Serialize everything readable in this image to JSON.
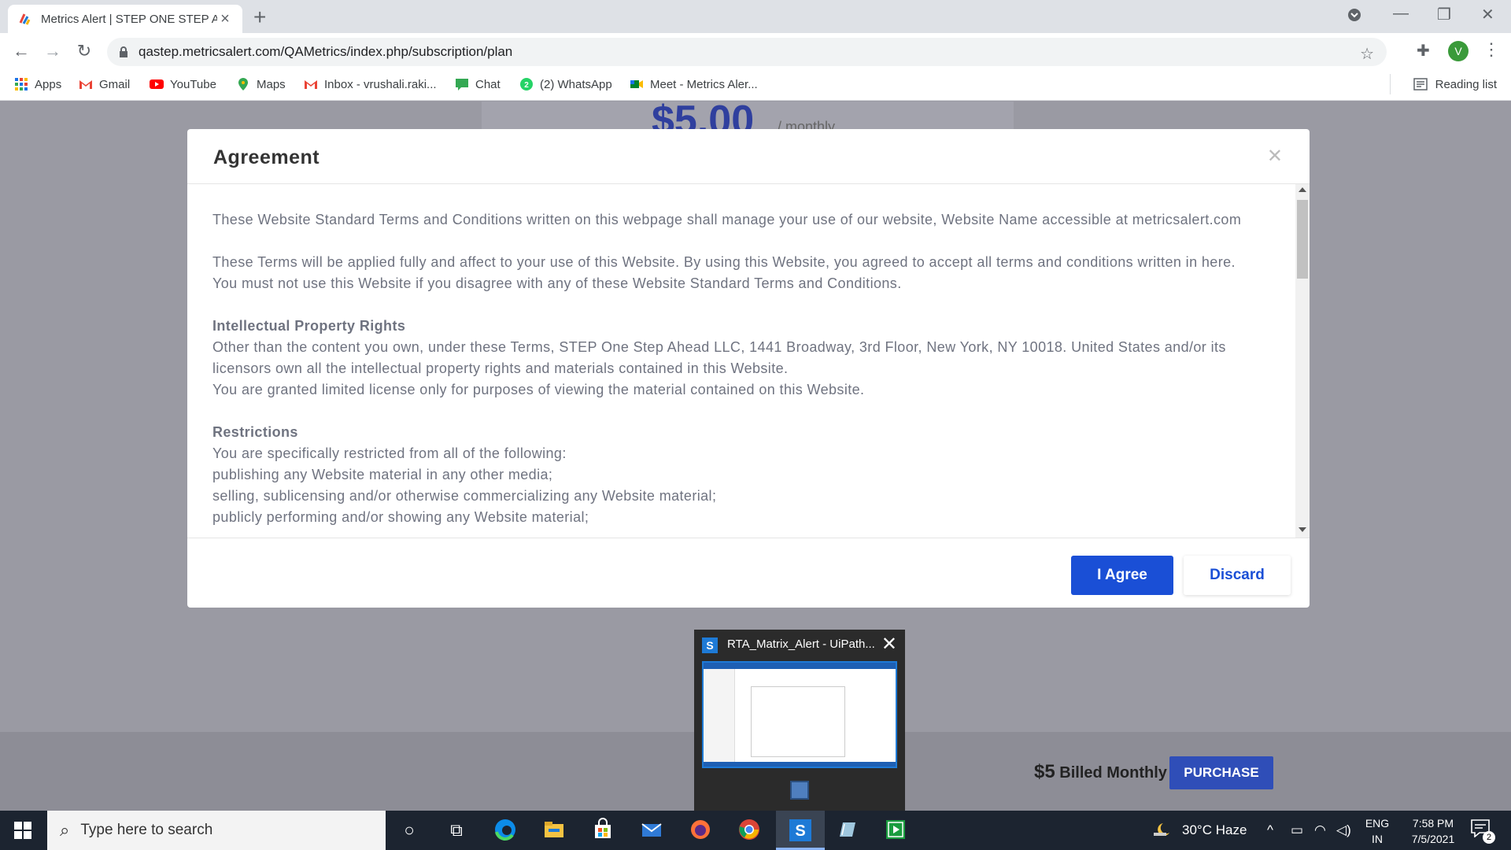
{
  "browser": {
    "tab_title": "Metrics Alert | STEP ONE STEP AHEAD",
    "url": "qastep.metricsalert.com/QAMetrics/index.php/subscription/plan",
    "avatar_letter": "V",
    "bookmarks": [
      {
        "label": "Apps",
        "icon": "apps-grid-icon"
      },
      {
        "label": "Gmail",
        "icon": "gmail-icon"
      },
      {
        "label": "YouTube",
        "icon": "youtube-icon"
      },
      {
        "label": "Maps",
        "icon": "maps-pin-icon"
      },
      {
        "label": "Inbox - vrushali.raki...",
        "icon": "gmail-icon"
      },
      {
        "label": "Chat",
        "icon": "chat-icon"
      },
      {
        "label": "(2) WhatsApp",
        "icon": "whatsapp-icon"
      },
      {
        "label": "Meet - Metrics Aler...",
        "icon": "meet-icon"
      }
    ],
    "reading_list": "Reading list"
  },
  "page": {
    "price": "$5.00",
    "price_period": "/ monthly",
    "billed_amount": "$5",
    "billed_label": "Billed Monthly",
    "purchase_label": "PURCHASE"
  },
  "modal": {
    "title": "Agreement",
    "paragraph1": "These Website Standard Terms and Conditions written on this webpage shall manage your use of our website, Website Name accessible at metricsalert.com",
    "paragraph2": "These Terms will be applied fully and affect to your use of this Website. By using this Website, you agreed to accept all terms and conditions written in here. You must not use this Website if you disagree with any of these Website Standard Terms and Conditions.",
    "ip_heading": "Intellectual Property Rights",
    "ip_text1": "Other than the content you own, under these Terms, STEP One Step Ahead LLC, 1441 Broadway, 3rd Floor, New York, NY 10018. United States and/or its licensors own all the intellectual property rights and materials contained in this Website.",
    "ip_text2": "You are granted limited license only for purposes of viewing the material contained on this Website.",
    "restrictions_heading": "Restrictions",
    "restrictions_intro": "You are specifically restricted from all of the following:",
    "restriction1": "publishing any Website material in any other media;",
    "restriction2": "selling, sublicensing and/or otherwise commercializing any Website material;",
    "restriction3": "publicly performing and/or showing any Website material;",
    "agree_label": "I Agree",
    "discard_label": "Discard"
  },
  "thumbnail": {
    "title": "RTA_Matrix_Alert - UiPath..."
  },
  "taskbar": {
    "search_placeholder": "Type here to search",
    "weather": "30°C  Haze",
    "lang1": "ENG",
    "lang2": "IN",
    "time": "7:58 PM",
    "date": "7/5/2021",
    "notification_count": "2"
  },
  "colors": {
    "primary_button": "#1a4fd6",
    "purchase_button": "#2f4eb8",
    "overlay": "#9a9aa3"
  }
}
